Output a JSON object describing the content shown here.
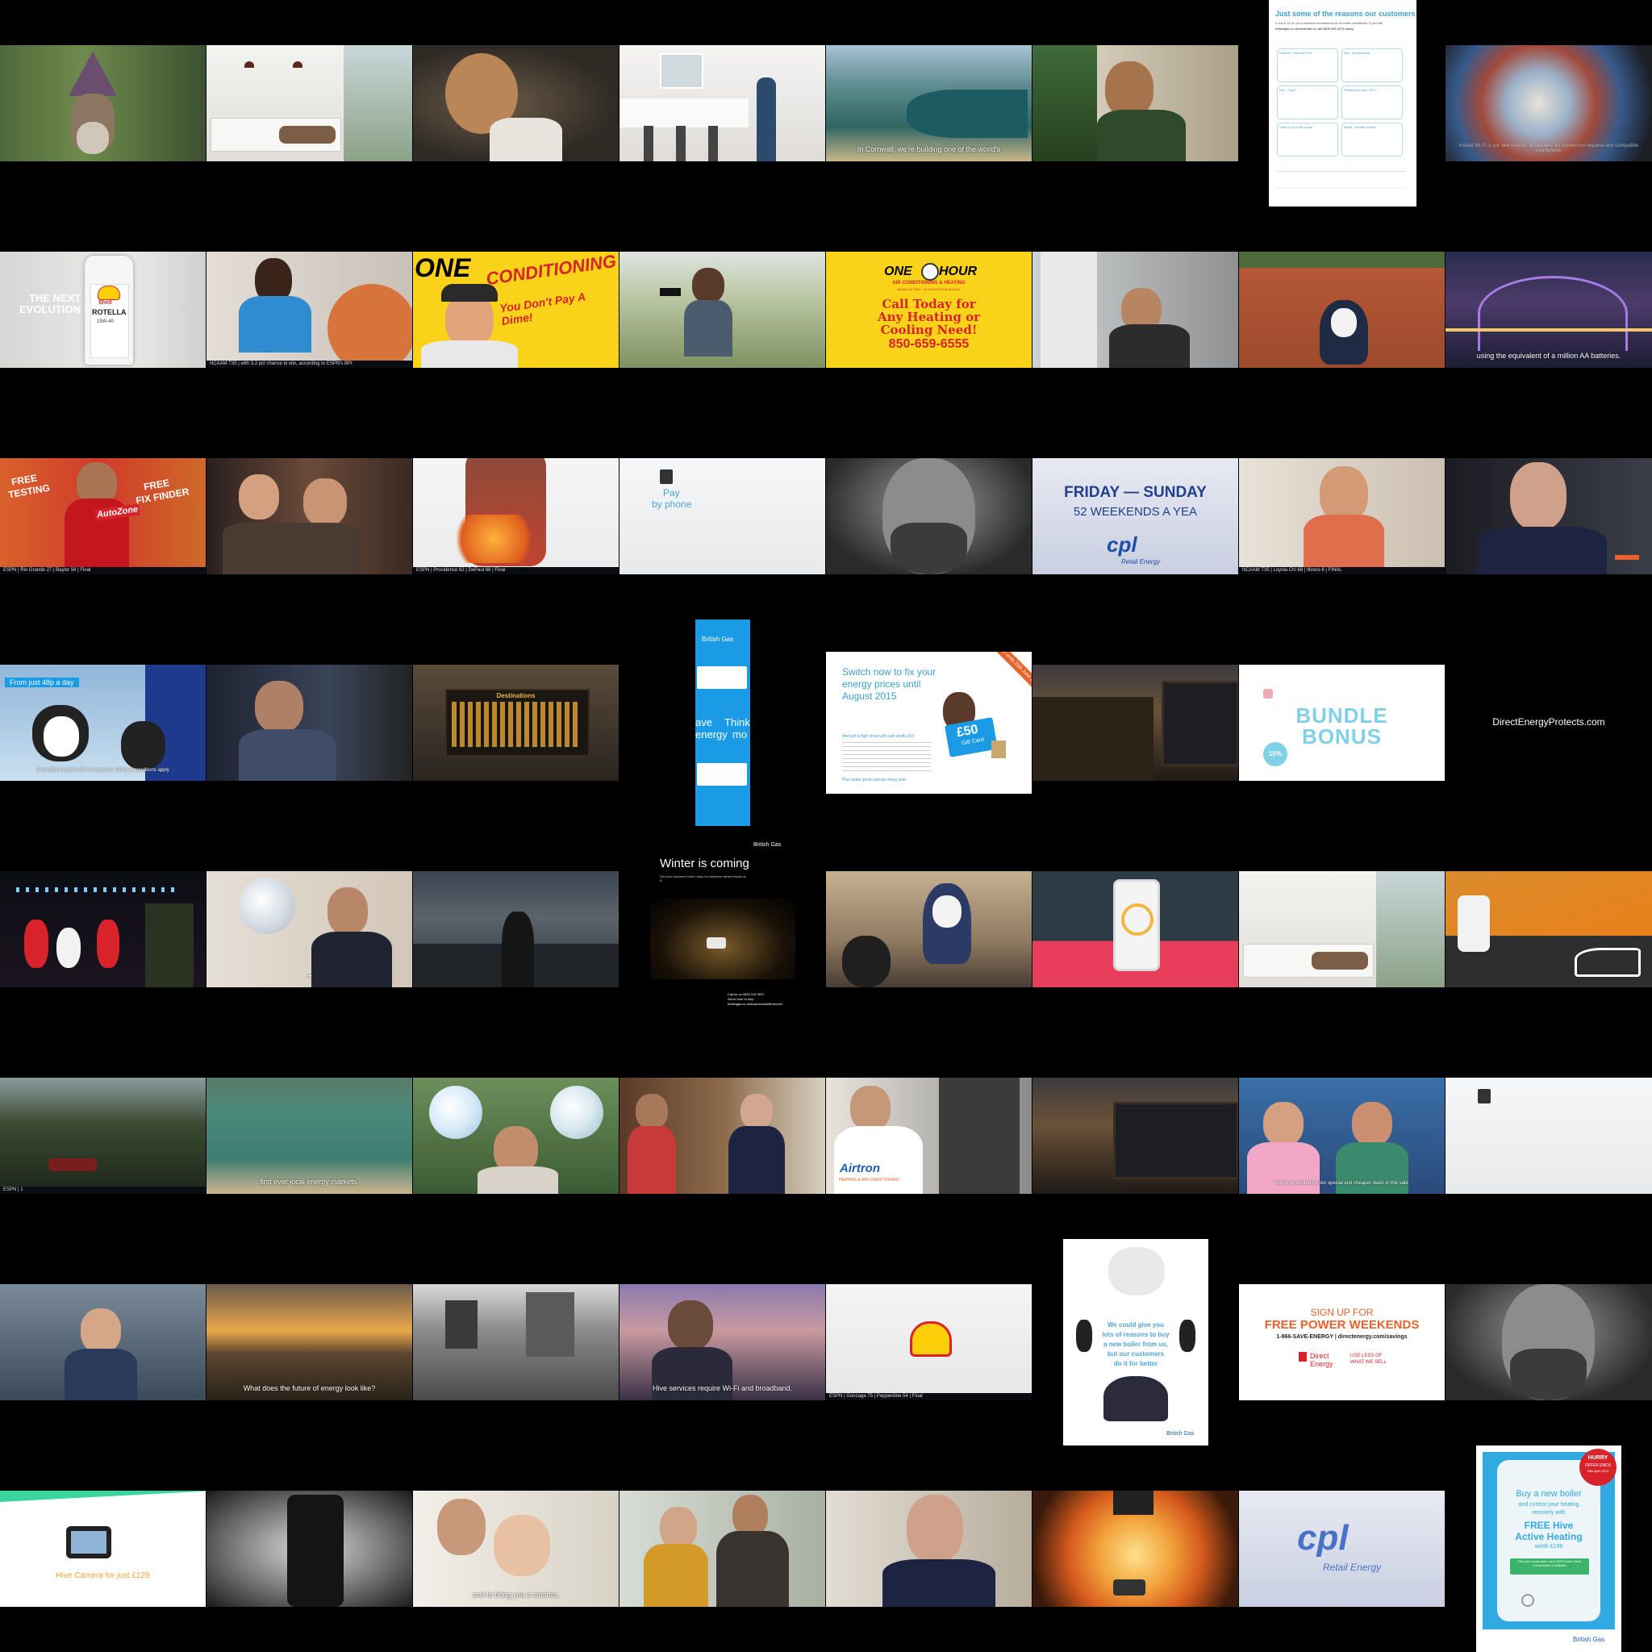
{
  "tiles": {
    "r1c5_caption": "In Cornwall, we're building one of the world's",
    "r1c7": {
      "title": "Just some of the reasons our customers",
      "sub": "9 out of 10 of our customers recommend us for boiler installation. If you like",
      "link": "britishgas.co.uk/newboiler or call 0800 008 4376 today.",
      "box1": "Finance? Interest Free",
      "box2": "Not - Service/Cost",
      "box3": "Hot... Fast?",
      "box4": "Efficiency boost - ECO",
      "box5": "Save up to £195 a year",
      "box6": "Boost - remote control"
    },
    "r1c8_caption": "Instant Wi-Fi is our new service. Broadband 3G connection required and compatible smartphone.",
    "r2c1": {
      "line1": "THE NEXT",
      "line2": "EVOLUTION",
      "brand": "Shell",
      "product": "ROTELLA",
      "grade": "15W-40"
    },
    "r2c2_ticker": "NCAAM T35  |  with 3.2 pct chance to win, according to ESPN's BPI",
    "r2c3": {
      "text": "You Don't Pay A Dime!",
      "word": "CONDITIONING",
      "brand": "ONE"
    },
    "r2c5": {
      "brand1": "ONE",
      "brand2": "HOUR",
      "sub1": "AIR CONDITIONING & HEATING",
      "sub2": "Always On Time...Or You Don't Pay A Dime!",
      "cta1": "Call Today for",
      "cta2": "Any Heating or",
      "cta3": "Cooling Need!",
      "phone": "850-659-6555"
    },
    "r2c8_caption": "using the equivalent of a million AA batteries.",
    "r3c1": {
      "t1": "FREE",
      "t2": "TESTING",
      "t3": "FREE",
      "t4": "FIX FINDER",
      "brand": "AutoZone",
      "ticker": "ESPN  |  Rio Grande  27  |  Baylor  56  |  Final"
    },
    "r3c3_ticker": "ESPN  |  Providence  62  |  DePaul  66  |  Final",
    "r3c4": {
      "line1": "Pay",
      "line2": "by phone"
    },
    "r3c6": {
      "line1": "FRIDAY — SUNDAY",
      "line2": "52 WEEKENDS A YEA",
      "brand": "cpl",
      "brand_sub": "Retail Energy"
    },
    "r3c7_ticker": "NCAAM T35  |  Loyola Chi  68  |  Illinois  6  |  FINAL",
    "r4c1": {
      "headline": "From just 48p a day",
      "fine": "From £13 a month with no extra fee. Terms & conditions apply"
    },
    "r4c3_board": "Destinations",
    "r4c4": {
      "brand": "British Gas",
      "word1": "ave",
      "word2": "Think",
      "word3": "energy",
      "word4": "mo"
    },
    "r4c5": {
      "title1": "Switch now to fix your",
      "title2": "energy prices until",
      "title3": "August 2015",
      "badge": "Offer ends 25th June 2014",
      "card": "£50",
      "card_sub": "Gift Card",
      "body1": "And get a high street gift card worth £50",
      "body2": "Plus make great savings every year"
    },
    "r4c7": {
      "line1": "BUNDLE",
      "line2": "BONUS",
      "badge": "10%"
    },
    "r4c8_url": "DirectEnergyProtects.com",
    "r5c4": {
      "brand": "British Gas",
      "headline": "Winter is coming",
      "sub": "Get your business boiler ready for whatever winter throws at it.",
      "cta": "Call us on 0800 316 3097",
      "cta2": "We're here to help",
      "url": "britishgas.co.uk/business/boilerservice"
    },
    "r6c1_ticker": "ESPN  |  1",
    "r6c2_caption": "first ever local energy markets.",
    "r6c5": {
      "brand": "Airtron",
      "sub": "HEATING & AIR CONDITIONING"
    },
    "r6c7_caption": "We're so excited for our special and cheaper deals in this sale",
    "r7c2_caption": "What does the future of energy look like?",
    "r7c4_caption": "Hive services require Wi-Fi and broadband.",
    "r7c5_ticker": "ESPN  |  Gonzaga  75  |  Pepperdine  54  |  Final",
    "r7c6": {
      "line1": "We could give you",
      "line2": "lots of reasons to buy",
      "line3": "a new boiler from us,",
      "line4": "but our customers",
      "line5": "do it for better",
      "brand": "British Gas"
    },
    "r7c7": {
      "line1": "SIGN UP FOR",
      "line2": "FREE POWER WEEKENDS",
      "line3": "1-866-SAVE-ENERGY  |  directenergy.com/savings",
      "brand1": "Direct",
      "brand2": "Energy",
      "tag1": "USE LESS OF",
      "tag2": "WHAT WE SELL"
    },
    "r8c1_caption": "Hive Camera for just £129",
    "r8c3_caption": "and to bring you a smarter,",
    "r8c7": {
      "brand": "cpl",
      "brand_sub": "Retail Energy"
    },
    "r8c8": {
      "badge1": "HURRY",
      "badge2": "OFFER ENDS",
      "badge3": "30th April 2014",
      "line1": "Buy a new boiler",
      "line2": "and control your heating",
      "line3": "remotely with",
      "line4": "FREE Hive",
      "line5": "Active Heating",
      "line6": "worth £199",
      "btn": "Plus you could claim up to £270 Green Deal Government Cashback",
      "brand": "British Gas"
    }
  },
  "colors": {
    "bg": "#000000",
    "bg_blue": "#1b9be6",
    "yellow": "#f9d21a",
    "red": "#d8232a",
    "cpl_blue": "#214ea6",
    "direct_orange": "#e8622c"
  }
}
